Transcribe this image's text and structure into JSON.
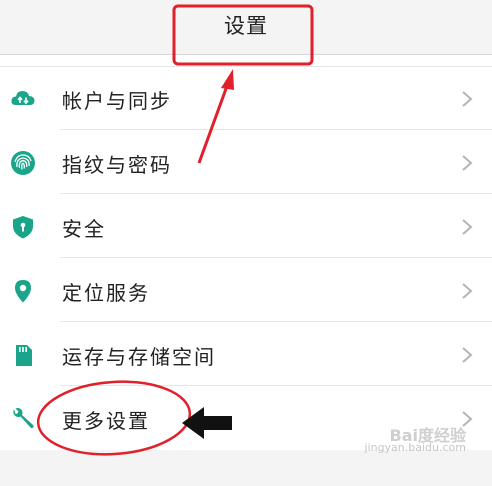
{
  "header": {
    "title": "设置"
  },
  "settings": {
    "items": [
      {
        "label": "帐户与同步",
        "icon": "cloud-sync-icon"
      },
      {
        "label": "指纹与密码",
        "icon": "fingerprint-icon"
      },
      {
        "label": "安全",
        "icon": "shield-icon"
      },
      {
        "label": "定位服务",
        "icon": "location-pin-icon"
      },
      {
        "label": "运存与存储空间",
        "icon": "sd-card-icon"
      },
      {
        "label": "更多设置",
        "icon": "wrench-icon"
      }
    ]
  },
  "colors": {
    "accent": "#1aa58a",
    "chevron": "#b4b4b4",
    "annotation_red": "#e0202a",
    "annotation_black": "#111111"
  },
  "watermark": {
    "main": "Bai度经验",
    "sub": "jingyan.baidu.com"
  }
}
